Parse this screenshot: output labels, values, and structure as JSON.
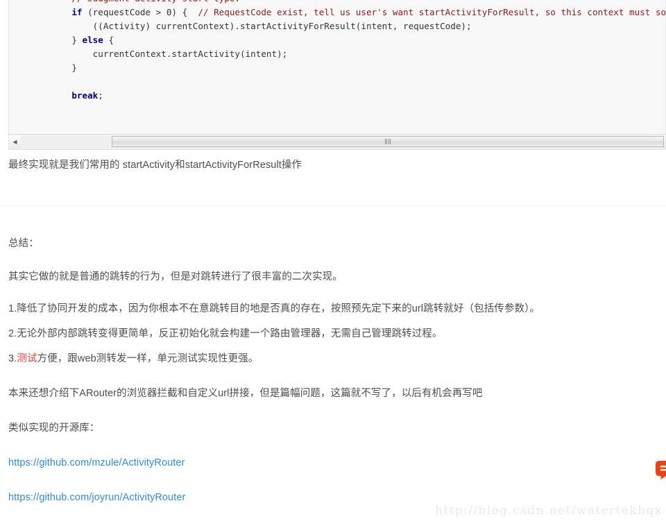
{
  "code_block": {
    "language": "java",
    "lines": [
      {
        "indent": 1,
        "tokens": [
          {
            "t": "}",
            "c": "pl"
          }
        ]
      },
      {
        "indent": 0,
        "tokens": []
      },
      {
        "indent": 1,
        "tokens": [
          {
            "t": "// Judgment activity start type.",
            "c": "cm"
          }
        ]
      },
      {
        "indent": 1,
        "tokens": [
          {
            "t": "if",
            "c": "kw"
          },
          {
            "t": " (requestCode > 0) {  ",
            "c": "pl"
          },
          {
            "t": "// RequestCode exist, tell us user's want startActivityForResult, so this context must son of activity.",
            "c": "cm"
          }
        ]
      },
      {
        "indent": 2,
        "tokens": [
          {
            "t": "((Activity) currentContext).startActivityForResult(intent, requestCode);",
            "c": "pl"
          }
        ]
      },
      {
        "indent": 1,
        "tokens": [
          {
            "t": "} ",
            "c": "pl"
          },
          {
            "t": "else",
            "c": "kw"
          },
          {
            "t": " {",
            "c": "pl"
          }
        ]
      },
      {
        "indent": 2,
        "tokens": [
          {
            "t": "currentContext.startActivity(intent);",
            "c": "pl"
          }
        ]
      },
      {
        "indent": 1,
        "tokens": [
          {
            "t": "}",
            "c": "pl"
          }
        ]
      },
      {
        "indent": 0,
        "tokens": []
      },
      {
        "indent": 1,
        "tokens": [
          {
            "t": "break",
            "c": "kw"
          },
          {
            "t": ";",
            "c": "pl"
          }
        ]
      }
    ],
    "scrollbar": {
      "left_arrow": "◀",
      "right_arrow": "▶",
      "grip": "|||"
    }
  },
  "article": {
    "p_result": "最终实现就是我们常用的 startActivity和startActivityForResult操作",
    "heading_summary": "总结：",
    "p_summary": "其实它做的就是普通的跳转的行为，但是对跳转进行了很丰富的二次实现。",
    "p_point1": "1.降低了协同开发的成本，因为你根本不在意跳转目的地是否真的存在，按照预先定下来的url跳转就好（包括传参数）。",
    "p_point2": "2.无论外部内部跳转变得更简单，反正初始化就会构建一个路由管理器，无需自己管理跳转过程。",
    "p_point3_prefix": "3.",
    "p_point3_highlight": "测试",
    "p_point3_rest": "方便，跟web测转发一样，单元测试实现性更强。",
    "p_outro": "本来还想介绍下ARouter的浏览器拦截和自定义url拼接，但是篇幅问题，这篇就不写了，以后有机会再写吧",
    "p_libs_label": "类似实现的开源库：",
    "link1": "https://github.com/mzule/ActivityRouter",
    "link2": "https://github.com/joyrun/ActivityRouter"
  },
  "watermark": {
    "text": "http://blog.csdn.net/watertekhqx"
  },
  "float_widget": {
    "icon_name": "feedback-widget-icon",
    "color": "#ef4213"
  },
  "colors": {
    "code_bg": "#f8f8f8",
    "keyword": "#000080",
    "comment": "#8b1a1a",
    "text": "#4d4d4d",
    "link": "#2a8fd4",
    "highlight_red": "#e23c3c",
    "watermark": "#e8e8e8"
  }
}
